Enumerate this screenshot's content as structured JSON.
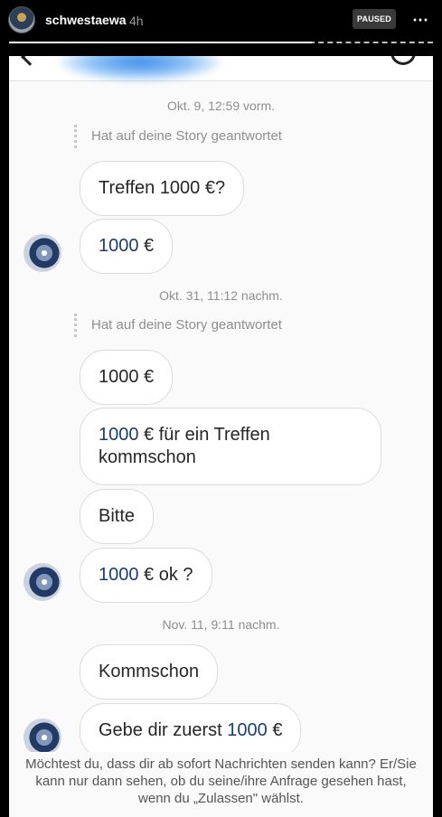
{
  "story": {
    "username": "schwestaewa",
    "time": "4h",
    "status_badge": "PAUSED",
    "more_icon": "⋯"
  },
  "chat": {
    "messages": {
      "ts1": "Okt. 9, 12:59 vorm.",
      "reply1": "Hat auf deine Story geantwortet",
      "b1": "Treffen 1000 €?",
      "b2_num": "1000",
      "b2_rest": " €",
      "ts2": "Okt. 31, 11:12 nachm.",
      "reply2": "Hat auf deine Story geantwortet",
      "b3": "1000 €",
      "b4_num": "1000",
      "b4_rest": " € für ein Treffen kommschon",
      "b5": "Bitte",
      "b6_num": "1000",
      "b6_rest": " € ok ?",
      "ts3": "Nov. 11, 9:11 nachm.",
      "b7": "Kommschon",
      "b8_pre": "Gebe dir zuerst ",
      "b8_num": "1000",
      "b8_rest": " €"
    },
    "request_banner": "Möchtest du, dass                    dir ab sofort Nachrichten senden kann? Er/Sie kann nur dann sehen, ob du seine/ihre Anfrage gesehen hast, wenn du „Zulassen\" wählst."
  }
}
